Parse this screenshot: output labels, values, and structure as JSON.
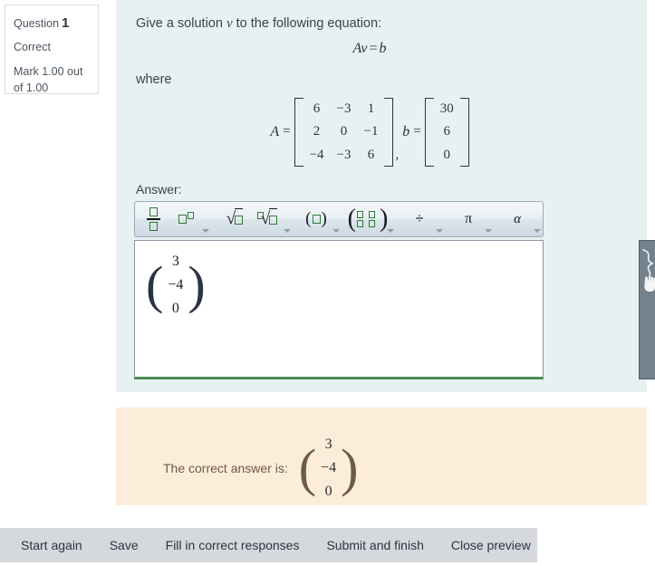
{
  "question_info": {
    "label": "Question",
    "number": "1",
    "state": "Correct",
    "grade": "Mark 1.00 out of 1.00"
  },
  "question": {
    "prompt_before": "Give a solution",
    "prompt_var": "v",
    "prompt_after": "to the following equation:",
    "equation_lhs_a": "A",
    "equation_lhs_v": "v",
    "equation_op": "=",
    "equation_rhs": "b",
    "where": "where",
    "matrix_a_label": "A",
    "matrix_equals": "=",
    "matrix_a": [
      [
        "6",
        "−3",
        "1"
      ],
      [
        "2",
        "0",
        "−1"
      ],
      [
        "−4",
        "−3",
        "6"
      ]
    ],
    "separator": ",",
    "vector_b_label": "b",
    "vector_b_equals": "=",
    "vector_b": [
      "30",
      "6",
      "0"
    ]
  },
  "answer": {
    "label": "Answer:",
    "vector": [
      "3",
      "−4",
      "0"
    ],
    "left_paren": "(",
    "right_paren": ")",
    "status_icon": "check-icon",
    "status": "correct"
  },
  "toolbar": {
    "buttons": [
      {
        "name": "fraction-button",
        "icon": "fraction-icon",
        "has_dropdown": false
      },
      {
        "name": "superscript-button",
        "icon": "superscript-icon",
        "has_dropdown": true
      },
      {
        "name": "square-root-button",
        "icon": "square-root-icon",
        "has_dropdown": false
      },
      {
        "name": "nth-root-button",
        "icon": "nth-root-icon",
        "has_dropdown": true
      },
      {
        "name": "parenthesis-button",
        "icon": "parenthesis-icon",
        "has_dropdown": true
      },
      {
        "name": "matrix-button",
        "icon": "matrix-icon",
        "has_dropdown": true
      },
      {
        "name": "divide-button",
        "icon": "divide-icon",
        "has_dropdown": true
      },
      {
        "name": "pi-button",
        "icon": "pi-symbol-icon",
        "has_dropdown": true
      },
      {
        "name": "greek-alpha-button",
        "icon": "alpha-symbol-icon",
        "has_dropdown": true
      },
      {
        "name": "undo-button",
        "icon": "undo-arrow-icon",
        "has_dropdown": false
      },
      {
        "name": "redo-button",
        "icon": "redo-arrow-icon",
        "has_dropdown": true
      },
      {
        "name": "help-button",
        "icon": "question-mark-icon",
        "has_dropdown": false
      }
    ],
    "divide_symbol": "÷",
    "pi_symbol": "π",
    "alpha_symbol": "α",
    "undo_symbol": "↶",
    "redo_symbol": "↷",
    "help_symbol": "?"
  },
  "feedback": {
    "text": "The correct answer is:",
    "vector": [
      "3",
      "−4",
      "0"
    ],
    "left_paren": "(",
    "right_paren": ")"
  },
  "actions": [
    {
      "name": "start-again-button",
      "label": "Start again"
    },
    {
      "name": "save-button",
      "label": "Save"
    },
    {
      "name": "fill-correct-responses-button",
      "label": "Fill in correct responses"
    },
    {
      "name": "submit-and-finish-button",
      "label": "Submit and finish"
    },
    {
      "name": "close-preview-button",
      "label": "Close preview"
    }
  ],
  "colors": {
    "question_panel_bg": "#e7f1f2",
    "feedback_panel_bg": "#fceddb",
    "action_bar_bg": "#d5d9dd",
    "correct_green": "#2f8a3e",
    "drag_handle": "#74828d",
    "editor_green": "#2e7d32"
  }
}
